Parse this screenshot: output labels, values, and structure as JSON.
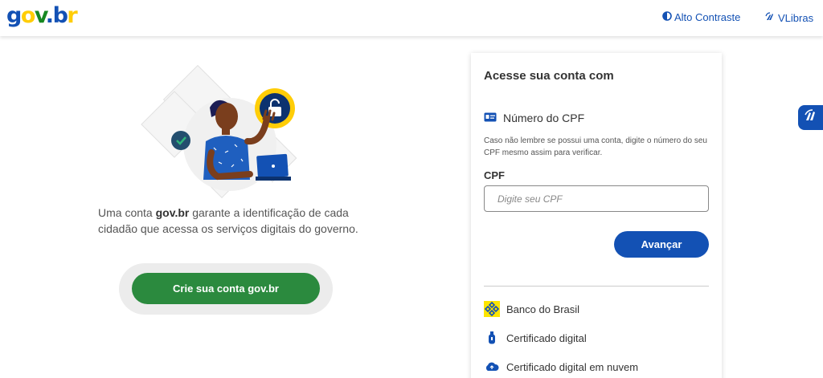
{
  "header": {
    "logo": {
      "g": "g",
      "o": "o",
      "v": "v",
      "dot": ".",
      "b": "b",
      "r": "r"
    },
    "contrast_label": "Alto Contraste",
    "vlibras_label": "VLibras"
  },
  "intro": {
    "prefix": "Uma conta ",
    "brand": "gov.br",
    "suffix": " garante a identificação de cada cidadão que acessa os serviços digitais do governo."
  },
  "create_account_label": "Crie sua conta gov.br",
  "login": {
    "title": "Acesse sua conta com",
    "cpf_section_label": "Número do CPF",
    "hint": "Caso não lembre se possui uma conta, digite o número do seu CPF mesmo assim para verificar.",
    "cpf_field_label": "CPF",
    "cpf_placeholder": "Digite seu CPF",
    "cpf_value": "",
    "next_label": "Avançar",
    "options": [
      {
        "label": "Banco do Brasil",
        "icon": "banco-do-brasil-icon"
      },
      {
        "label": "Certificado digital",
        "icon": "usb-token-icon"
      },
      {
        "label": "Certificado digital em nuvem",
        "icon": "cloud-icon"
      }
    ]
  },
  "colors": {
    "primary": "#1351b4",
    "success": "#2b8a3e",
    "yellow": "#ffcd07",
    "green": "#168821"
  }
}
